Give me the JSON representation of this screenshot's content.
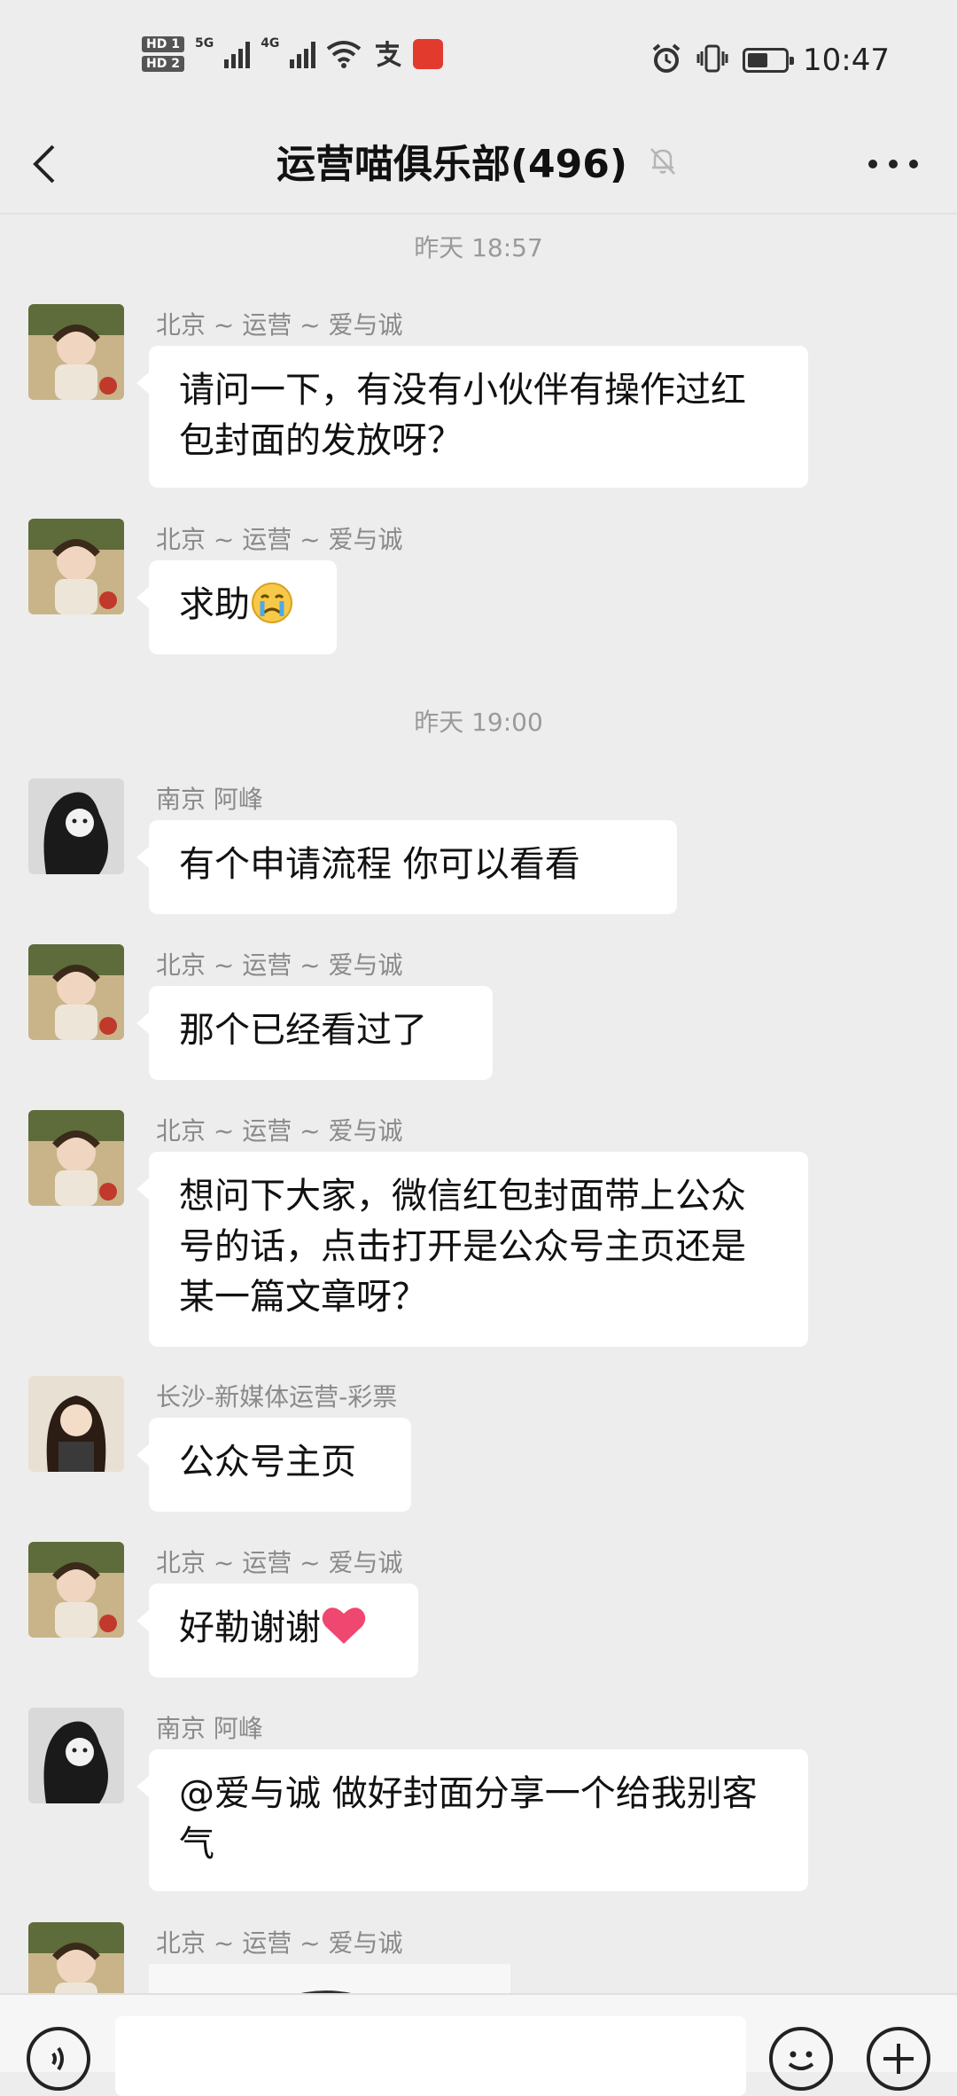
{
  "status_bar": {
    "hd1": "HD 1",
    "hd2": "HD 2",
    "network_1": "5G",
    "network_2": "4G",
    "time": "10:47",
    "battery_level": 0.55
  },
  "header": {
    "back_icon": "chevron-left-icon",
    "title": "运营喵俱乐部(496)",
    "mute_icon": "bell-off-icon",
    "more_icon": "more-dots-icon"
  },
  "timestamps": [
    "昨天 18:57",
    "昨天 19:00"
  ],
  "messages": [
    {
      "sender": "北京 ~ 运营 ~ 爱与诚",
      "text": "请问一下，有没有小伙伴有操作过红包封面的发放呀？"
    },
    {
      "sender": "北京 ~ 运营 ~ 爱与诚",
      "text": "求助",
      "emoji": "crying-face-icon"
    },
    {
      "sender": "南京  阿峰",
      "text": "有个申请流程  你可以看看"
    },
    {
      "sender": "北京 ~ 运营 ~ 爱与诚",
      "text": "那个已经看过了"
    },
    {
      "sender": "北京 ~ 运营 ~ 爱与诚",
      "text": "想问下大家，微信红包封面带上公众号的话，点击打开是公众号主页还是某一篇文章呀？"
    },
    {
      "sender": "长沙-新媒体运营-彩票",
      "text": "公众号主页"
    },
    {
      "sender": "北京 ~ 运营 ~ 爱与诚",
      "text": "好勒谢谢",
      "emoji": "heart-icon"
    },
    {
      "sender": "南京  阿峰",
      "text": "@爱与诚  做好封面分享一个给我别客气"
    },
    {
      "sender": "北京 ~ 运营 ~ 爱与诚",
      "text": ""
    }
  ],
  "bottom_bar": {
    "voice_icon": "voice-icon",
    "emoji_icon": "emoji-icon",
    "plus_icon": "plus-icon",
    "input_value": ""
  },
  "colors": {
    "background": "#ededed",
    "bubble": "#ffffff",
    "sender": "#8a8a8a",
    "timestamp": "#9a9a9a"
  }
}
